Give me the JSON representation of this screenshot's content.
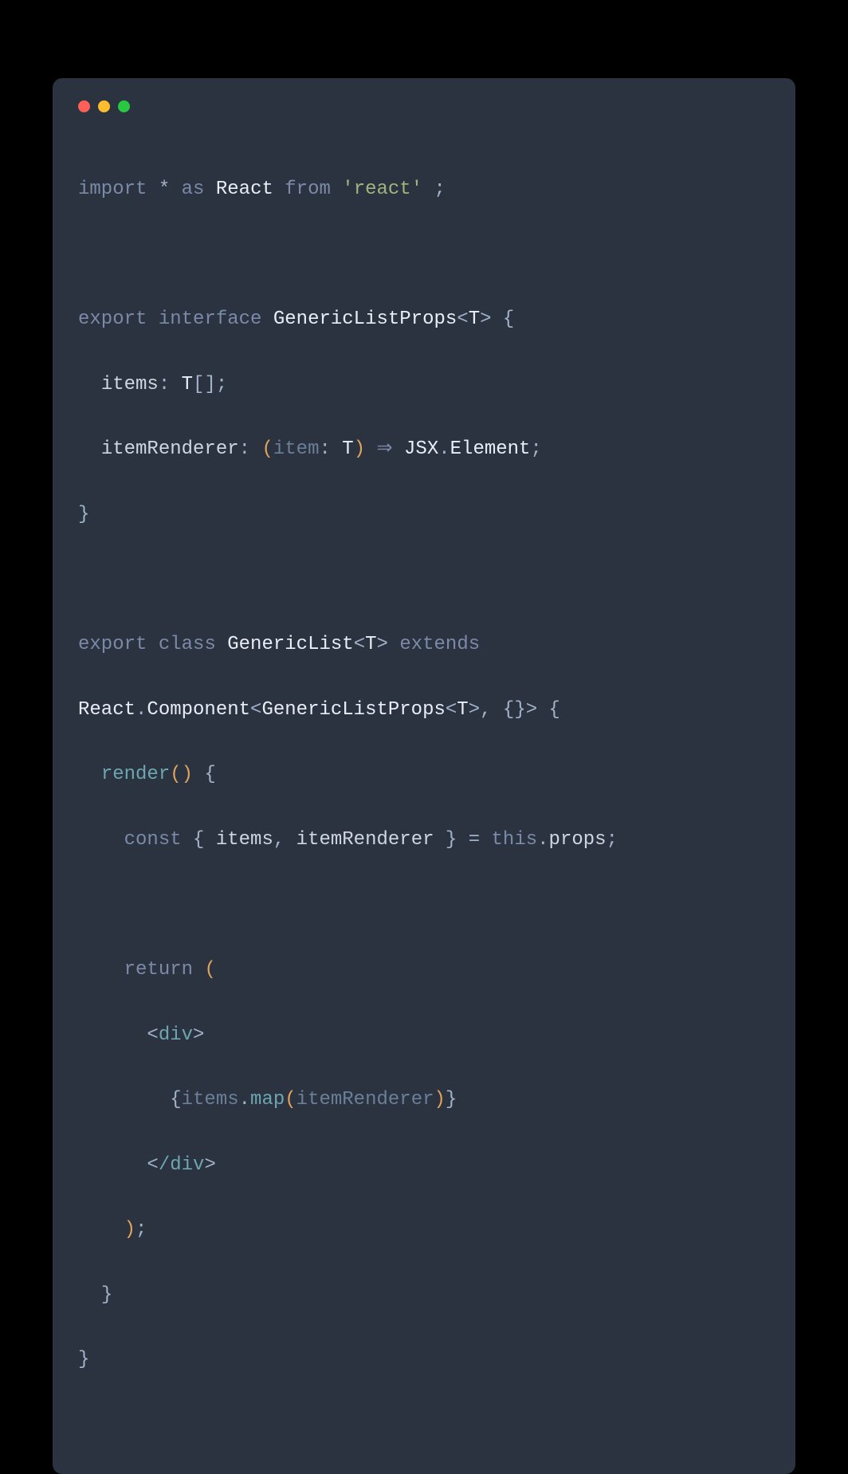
{
  "colors": {
    "window_bg": "#2b3240",
    "dot_red": "#ff5f57",
    "dot_yellow": "#febc2e",
    "dot_green": "#28c840"
  },
  "tok": {
    "import": "import",
    "star": "*",
    "as": "as",
    "React": "React",
    "from": "from",
    "react_str": "'react'",
    "semi": ";",
    "export": "export",
    "interface": "interface",
    "GenericListProps": "GenericListProps",
    "lt": "<",
    "gt": ">",
    "T": "T",
    "lbrace": "{",
    "rbrace": "}",
    "items": "items",
    "colon": ":",
    "brackets": "[]",
    "itemRenderer": "itemRenderer",
    "lparen": "(",
    "rparen": ")",
    "item": "item",
    "arrow": "⇒",
    "JSX": "JSX",
    "dot": ".",
    "Element": "Element",
    "class": "class",
    "GenericList": "GenericList",
    "extends": "extends",
    "Component": "Component",
    "comma": ",",
    "empty": "{}",
    "render": "render",
    "const": "const",
    "eq": "=",
    "this": "this",
    "props": "props",
    "return": "return",
    "div_open": "div",
    "div_close": "/div",
    "map": "map",
    "ind1": "  ",
    "ind2": "    ",
    "ind3": "      ",
    "ind4": "        "
  }
}
